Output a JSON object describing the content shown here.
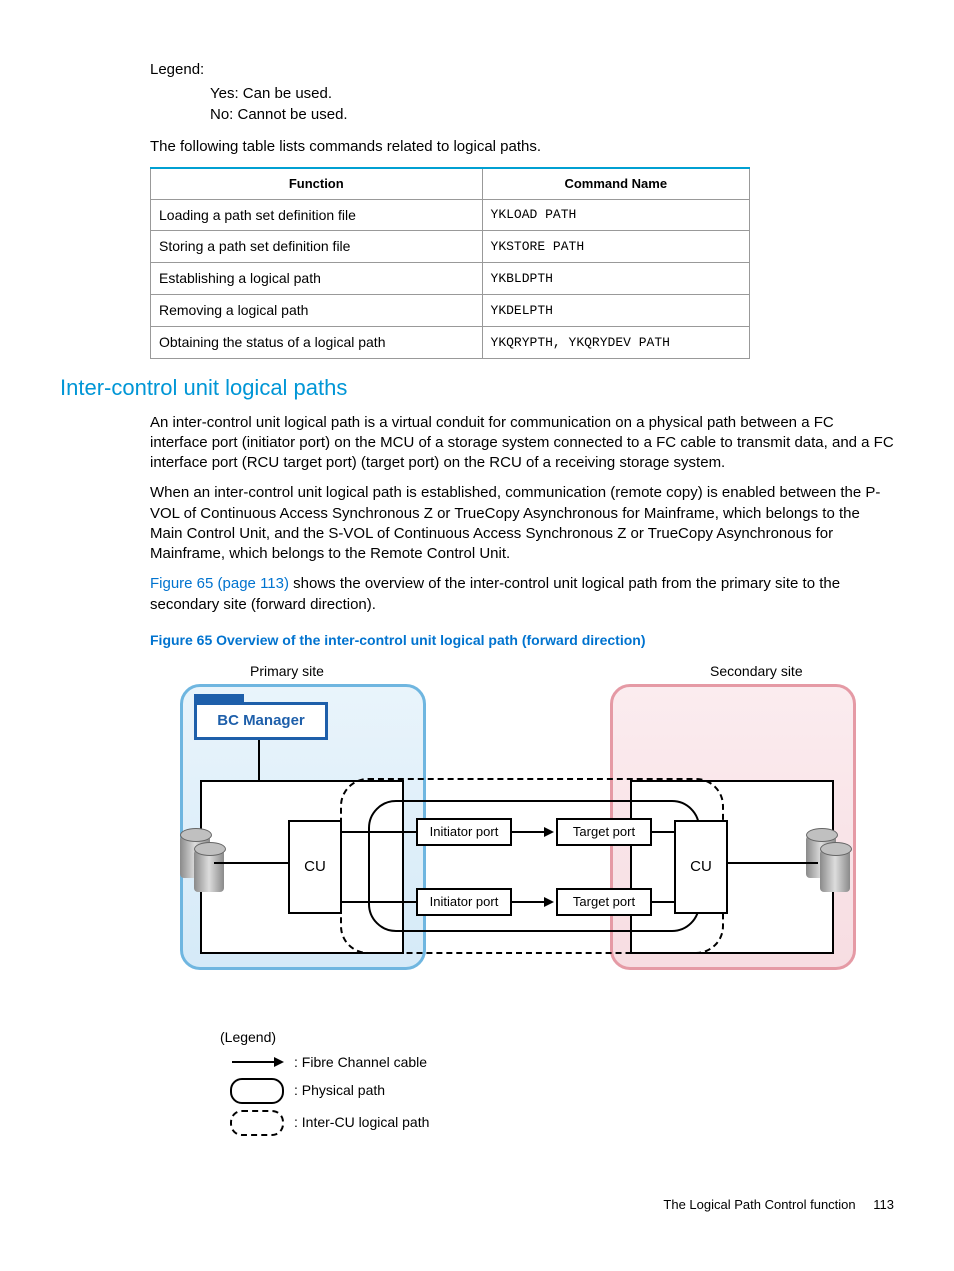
{
  "legend": {
    "title": "Legend:",
    "yes": "Yes: Can be used.",
    "no": "No: Cannot be used."
  },
  "intro_table": "The following table lists commands related to logical paths.",
  "table": {
    "headers": {
      "function": "Function",
      "command": "Command Name"
    },
    "rows": [
      {
        "fn": "Loading a path set definition file",
        "cmd": "YKLOAD PATH"
      },
      {
        "fn": "Storing a path set definition file",
        "cmd": "YKSTORE PATH"
      },
      {
        "fn": "Establishing a logical path",
        "cmd": "YKBLDPTH"
      },
      {
        "fn": "Removing a logical path",
        "cmd": "YKDELPTH"
      },
      {
        "fn": "Obtaining the status of a logical path",
        "cmd": "YKQRYPTH, YKQRYDEV PATH"
      }
    ]
  },
  "section_heading": "Inter-control unit logical paths",
  "p1": "An inter-control unit logical path is a virtual conduit for communication on a physical path between a FC interface port (initiator port) on the MCU of a storage system connected to a FC cable to transmit data, and a FC interface port (RCU target port) (target port) on the RCU of a receiving storage system.",
  "p2": "When an inter-control unit logical path is established, communication (remote copy) is enabled between the P-VOL of Continuous Access Synchronous Z or TrueCopy Asynchronous for Mainframe, which belongs to the Main Control Unit, and the S-VOL of Continuous Access Synchronous Z or TrueCopy Asynchronous for Mainframe, which belongs to the Remote Control Unit.",
  "figref_link": "Figure 65 (page 113)",
  "p3_tail": " shows the overview of the inter-control unit logical path from the primary site to the secondary site (forward direction).",
  "figcaption": "Figure 65 Overview of the inter-control unit logical path (forward direction)",
  "diagram": {
    "primary_site": "Primary site",
    "secondary_site": "Secondary site",
    "bc_manager": "BC Manager",
    "cu": "CU",
    "initiator": "Initiator port",
    "target": "Target port",
    "legend_title": "(Legend)",
    "fc_cable": ": Fibre Channel cable",
    "physical_path": ": Physical path",
    "logical_path": ": Inter-CU logical path"
  },
  "footer": {
    "section": "The Logical Path Control function",
    "page": "113"
  }
}
